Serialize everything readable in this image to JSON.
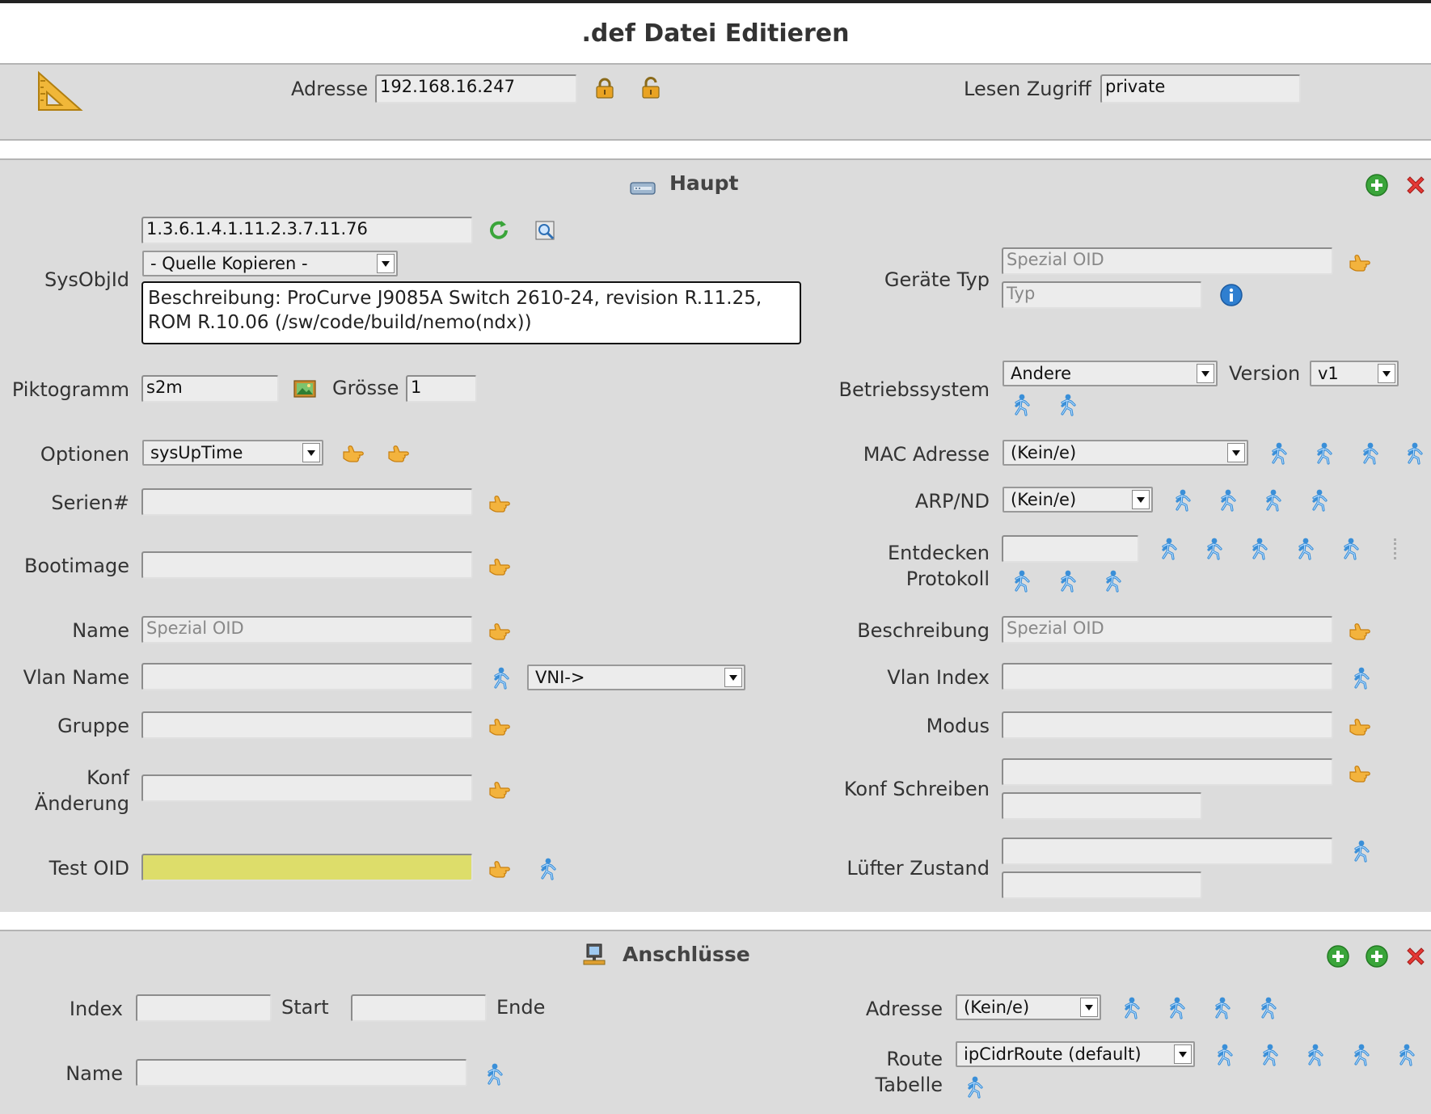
{
  "window_title": ".def Datei Editieren",
  "topbar": {
    "address_label": "Adresse",
    "address_value": "192.168.16.247",
    "read_access_label": "Lesen Zugriff",
    "read_access_value": "private"
  },
  "main": {
    "title": "Haupt",
    "sysobjid_label": "SysObjId",
    "sysobjid_value": "1.3.6.1.4.1.11.2.3.7.11.76",
    "copy_source_select": "- Quelle Kopieren -",
    "description_text": "Beschreibung: ProCurve J9085A Switch 2610-24, revision R.11.25, ROM R.10.06 (/sw/code/build/nemo(ndx))",
    "device_type_label": "Geräte Typ",
    "device_type_placeholder": "Spezial OID",
    "type_placeholder": "Typ",
    "pictogram_label": "Piktogramm",
    "pictogram_value": "s2m",
    "size_label": "Grösse",
    "size_value": "1",
    "os_label": "Betriebssystem",
    "os_select": "Andere",
    "version_label": "Version",
    "version_select": "v1",
    "options_label": "Optionen",
    "options_select": "sysUpTime",
    "mac_label": "MAC Adresse",
    "mac_select": "(Kein/e)",
    "serial_label": "Serien#",
    "arp_label": "ARP/ND",
    "arp_select": "(Kein/e)",
    "bootimage_label": "Bootimage",
    "discover_label_1": "Entdecken",
    "discover_label_2": "Protokoll",
    "name_label": "Name",
    "name_placeholder": "Spezial OID",
    "description_label": "Beschreibung",
    "description_placeholder": "Spezial OID",
    "vlan_name_label": "Vlan Name",
    "vni_select": "VNI->",
    "vlan_index_label": "Vlan Index",
    "group_label": "Gruppe",
    "mode_label": "Modus",
    "conf_change_label_1": "Konf",
    "conf_change_label_2": "Änderung",
    "conf_write_label": "Konf Schreiben",
    "test_oid_label": "Test OID",
    "fan_label": "Lüfter Zustand"
  },
  "ports": {
    "title": "Anschlüsse",
    "index_label": "Index",
    "start_label": "Start",
    "end_label": "Ende",
    "address_label": "Adresse",
    "address_select": "(Kein/e)",
    "name_label": "Name",
    "route_label_1": "Route",
    "route_label_2": "Tabelle",
    "route_select": "ipCidrRoute (default)"
  },
  "colors": {
    "panel_bg": "#dcdcdc",
    "test_oid_bg": "#dddd6a",
    "hand_icon": "#f0a830",
    "walker_icon": "#3a8fd8",
    "add_icon": "#3aa53a",
    "remove_icon": "#e53935"
  }
}
